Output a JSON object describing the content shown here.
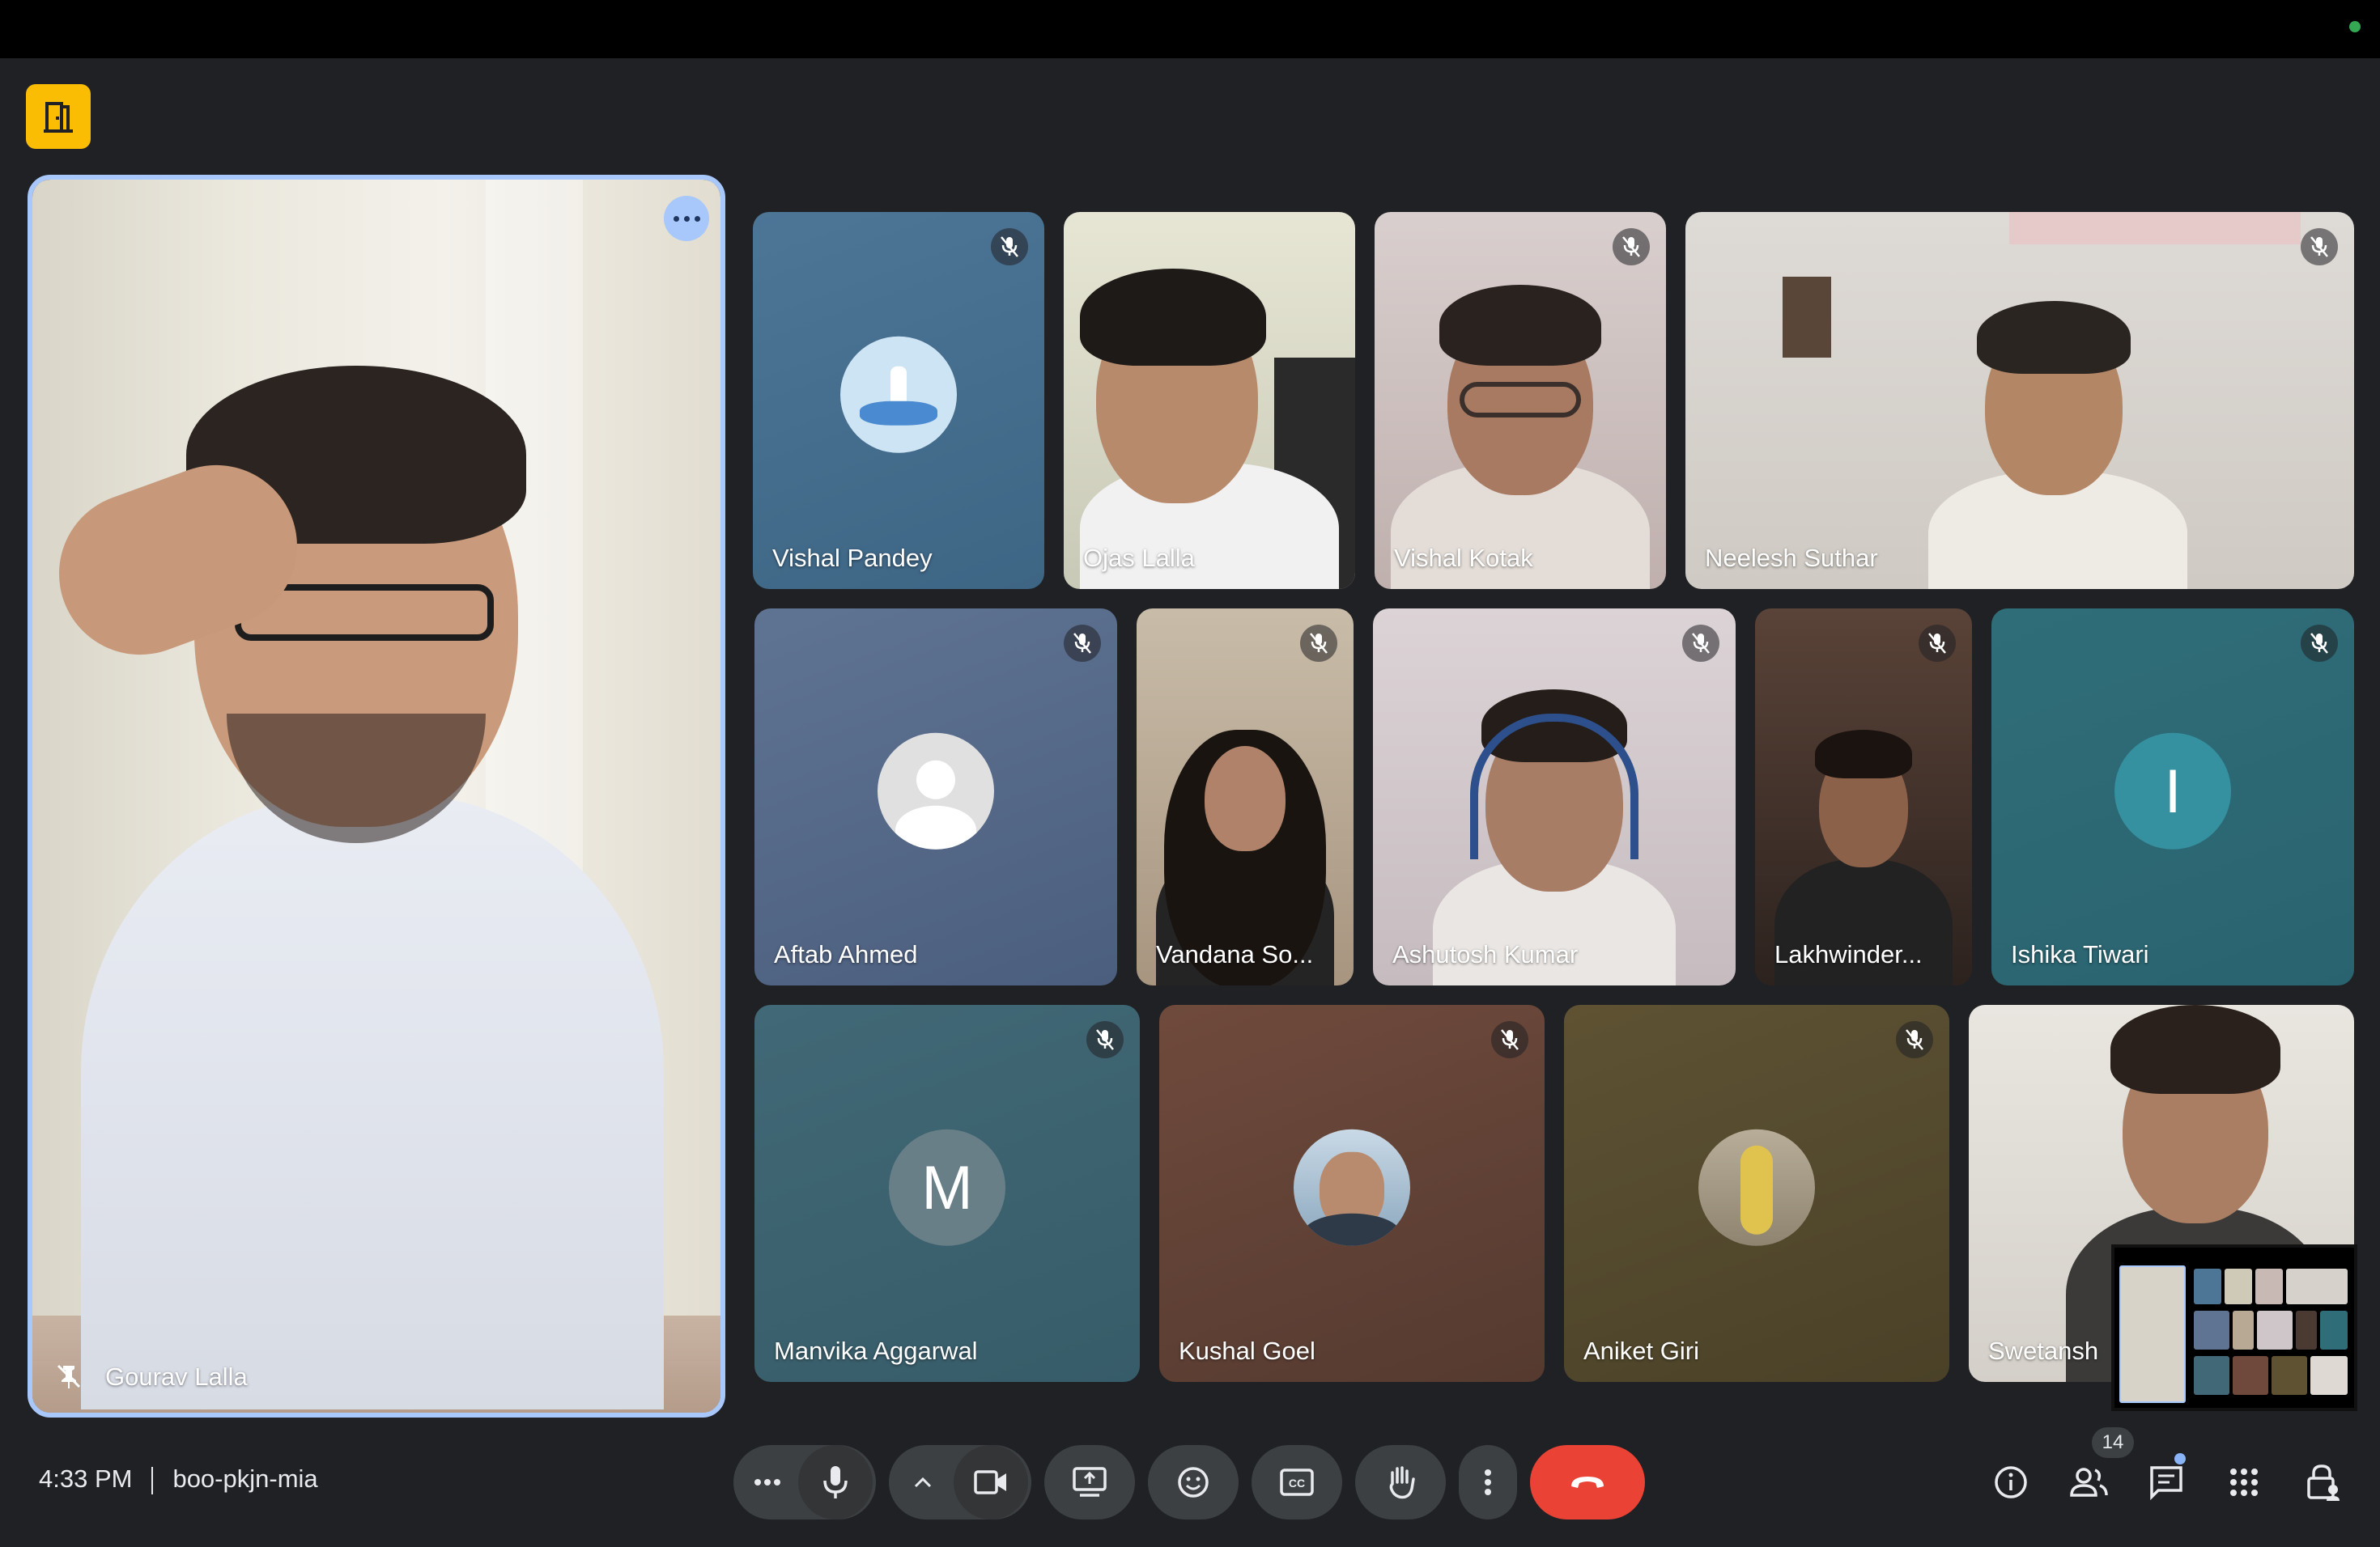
{
  "meeting": {
    "time": "4:33 PM",
    "code": "boo-pkjn-mia",
    "participant_count": "14"
  },
  "featured": {
    "name": "Gourav Lalla",
    "more_icon": "more-horiz-icon",
    "pin_icon": "pin-off-icon"
  },
  "tiles": {
    "vishal_pandey": "Vishal Pandey",
    "ojas_lalla": "Ojas Lalla",
    "vishal_kotak": "Vishal Kotak",
    "neelesh_suthar": "Neelesh Suthar",
    "aftab_ahmed": "Aftab Ahmed",
    "vandana": "Vandana So...",
    "ashutosh_kumar": "Ashutosh Kumar",
    "lakhwinder": "Lakhwinder...",
    "ishika_tiwari": "Ishika Tiwari",
    "manvika_aggarwal": "Manvika Aggarwal",
    "kushal_goel": "Kushal Goel",
    "aniket_giri": "Aniket Giri",
    "swetansh": "Swetansh"
  },
  "avatars": {
    "ishika": "I",
    "manvika": "M"
  },
  "colors": {
    "accent": "#a8c7fa",
    "leave": "#ea4335",
    "companion": "#fbbc04",
    "control_bg": "#3c4043"
  },
  "controls": {
    "more_options_icon": "more-horiz-icon",
    "mic_icon": "mic-icon",
    "camera_options_icon": "chevron-up-icon",
    "camera_icon": "videocam-icon",
    "present_icon": "present-screen-icon",
    "reactions_icon": "emoji-icon",
    "captions_icon": "closed-captions-icon",
    "raise_hand_icon": "hand-icon",
    "more_vert_icon": "more-vert-icon",
    "leave_icon": "call-end-icon",
    "info_icon": "info-icon",
    "people_icon": "people-icon",
    "chat_icon": "chat-icon",
    "activities_icon": "apps-grid-icon",
    "host_controls_icon": "lock-person-icon"
  }
}
